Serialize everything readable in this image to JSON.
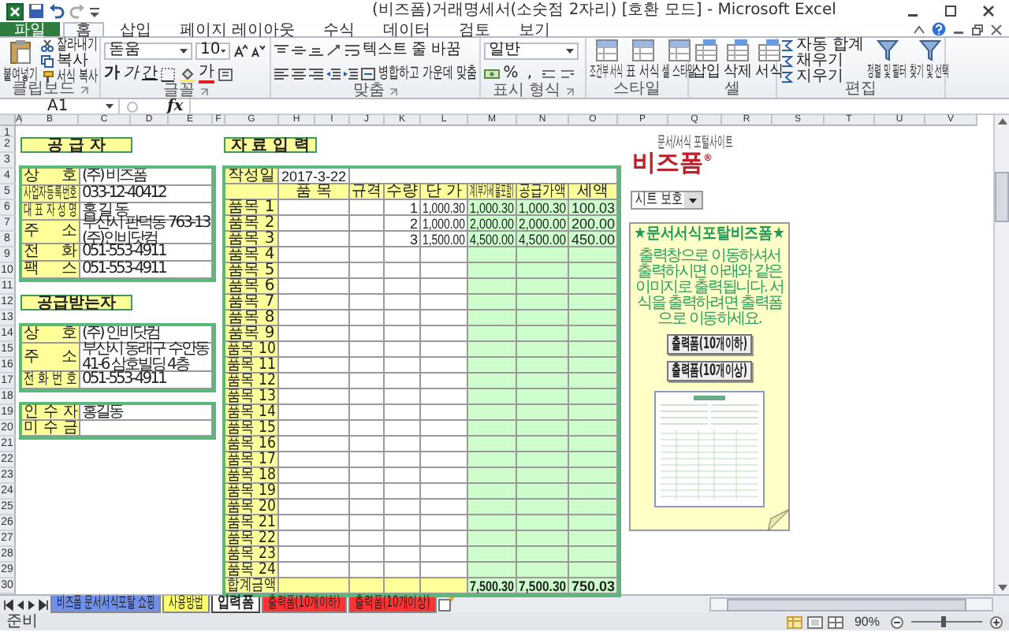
{
  "window": {
    "title": "(비즈폼)거래명세서(소숫점 2자리) [호환 모드] - Microsoft Excel"
  },
  "ribbon_tabs": [
    {
      "label": "파일",
      "kind": "file",
      "selected": false
    },
    {
      "label": "홈",
      "kind": "tab",
      "selected": true
    },
    {
      "label": "삽입",
      "kind": "tab",
      "selected": false
    },
    {
      "label": "페이지 레이아웃",
      "kind": "tab",
      "selected": false
    },
    {
      "label": "수식",
      "kind": "tab",
      "selected": false
    },
    {
      "label": "데이터",
      "kind": "tab",
      "selected": false
    },
    {
      "label": "검토",
      "kind": "tab",
      "selected": false
    },
    {
      "label": "보기",
      "kind": "tab",
      "selected": false
    }
  ],
  "ribbon_groups": [
    {
      "kind": "clipboard",
      "name": "클립보드",
      "paste": "붙여넣기",
      "cut": "잘라내기",
      "copy": "복사",
      "format_painter": "서식 복사"
    },
    {
      "kind": "font",
      "name": "글꼴",
      "font": "돋움",
      "size": "10",
      "bold": "가",
      "italic": "가",
      "underline": "간",
      "font_color": "가"
    },
    {
      "kind": "alignment",
      "name": "맞춤",
      "wrap": "텍스트 줄 바꿈",
      "merge": "병합하고 가운데 맞춤"
    },
    {
      "kind": "number",
      "name": "표시 형식",
      "format": "일반",
      "percent": "%",
      "comma": ","
    },
    {
      "kind": "styles",
      "name": "스타일",
      "buttons": [
        "조건부 서식",
        "표 서식",
        "셀 스타일"
      ]
    },
    {
      "kind": "cells",
      "name": "셀",
      "buttons": [
        "삽입",
        "삭제",
        "서식"
      ]
    },
    {
      "kind": "editing",
      "name": "편집",
      "small": [
        "자동 합계",
        "채우기",
        "지우기"
      ],
      "large": [
        "정렬 및 필터",
        "찾기 및 선택"
      ]
    }
  ],
  "formula_bar": {
    "cell": "A1",
    "function_label": "fx"
  },
  "column_headers": [
    "A",
    "B",
    "C",
    "D",
    "E",
    "F",
    "G",
    "H",
    "I",
    "J",
    "K",
    "L",
    "M",
    "N",
    "O",
    "P",
    "Q",
    "R",
    "S",
    "T",
    "U",
    "V"
  ],
  "row_headers": [
    "1",
    "2",
    "3",
    "4",
    "5",
    "6",
    "7",
    "8",
    "9",
    "10",
    "11",
    "12",
    "13",
    "14",
    "15",
    "16",
    "17",
    "18",
    "19",
    "20",
    "21",
    "22",
    "23",
    "24",
    "25",
    "26",
    "27",
    "28",
    "29",
    "30"
  ],
  "supplier": {
    "title": "공 급 자",
    "fields": [
      {
        "label": "상 호",
        "value": "(주) 비즈폼"
      },
      {
        "label": "사업자등록번호",
        "value": "033-12-40412"
      },
      {
        "label": "대 표 자 성 명",
        "value": "홍 길 동"
      },
      {
        "label": "주 소",
        "value": "부산시 판덕동 763-13 (주)인비닷컴"
      },
      {
        "label": "전 화",
        "value": "051-553-4911"
      },
      {
        "label": "팩 스",
        "value": "051-553-4911"
      }
    ]
  },
  "recipient": {
    "title": "공급받는자",
    "fields": [
      {
        "label": "상 호",
        "value": "(주) 인비닷컴"
      },
      {
        "label": "주 소",
        "value": "부산시 동래구 수안동 41-6 삼호빌딩 4층"
      },
      {
        "label": "전 화 번 호",
        "value": "051-553-4911"
      }
    ]
  },
  "receipt": {
    "fields": [
      {
        "label": "인 수 자",
        "value": "홍길동"
      },
      {
        "label": "미 수 금"
      }
    ]
  },
  "invoice": {
    "title": "자 료 입 력",
    "date_label": "작성일",
    "date": "2017-3-22",
    "columns": [
      "품 목",
      "규격",
      "수량",
      "단 가",
      "계(부가세율포함)",
      "공급가액",
      "세액"
    ],
    "items": [
      {
        "label": "품목 1",
        "qty": "1",
        "unit_price": "1,000.30",
        "total": "1,000.30",
        "supply": "1,000.30",
        "tax": "100.03"
      },
      {
        "label": "품목 2",
        "qty": "2",
        "unit_price": "1,000.00",
        "total": "2,000.00",
        "supply": "2,000.00",
        "tax": "200.00"
      },
      {
        "label": "품목 3",
        "qty": "3",
        "unit_price": "1,500.00",
        "total": "4,500.00",
        "supply": "4,500.00",
        "tax": "450.00"
      },
      {
        "label": "품목 4"
      },
      {
        "label": "품목 5"
      },
      {
        "label": "품목 6"
      },
      {
        "label": "품목 7"
      },
      {
        "label": "품목 8"
      },
      {
        "label": "품목 9"
      },
      {
        "label": "품목 10"
      },
      {
        "label": "품목 11"
      },
      {
        "label": "품목 12"
      },
      {
        "label": "품목 13"
      },
      {
        "label": "품목 14"
      },
      {
        "label": "품목 15"
      },
      {
        "label": "품목 16"
      },
      {
        "label": "품목 17"
      },
      {
        "label": "품목 18"
      },
      {
        "label": "품목 19"
      },
      {
        "label": "품목 20"
      },
      {
        "label": "품목 21"
      },
      {
        "label": "품목 22"
      },
      {
        "label": "품목 23"
      },
      {
        "label": "품목 24"
      }
    ],
    "totals": {
      "label": "합계금액",
      "total": "7,500.30",
      "supply": "7,500.30",
      "tax": "750.03"
    }
  },
  "logo": {
    "tagline": "문서/서식 포털사이트",
    "wordmark": "비즈폼$^{®}$"
  },
  "protect_dropdown": {
    "value": "시트 보호"
  },
  "note": {
    "title": "★문서서식포탈비즈폼★",
    "text": "출력창으로 이동하셔서 출력하시면 아래와 같은이미지로 출력됩니다. 서식을 출력하려면 출력폼으로 이동하세요.",
    "buttons": [
      "출력폼(10개이하)",
      "출력폼(10개이상)"
    ]
  },
  "sheet_tabs": [
    {
      "label": "비즈폼 문서서식포탈 쇼핑",
      "color": "#6f8fe8",
      "selected": false
    },
    {
      "label": "사용방법",
      "color": "#ffff66",
      "selected": false
    },
    {
      "label": "입력폼",
      "color": "#ffffff",
      "selected": true
    },
    {
      "label": "출력폼(10개이하)",
      "color": "#ff3333",
      "selected": false
    },
    {
      "label": "출력폼(10개이상)",
      "color": "#ff3333",
      "selected": false
    }
  ],
  "status_bar": {
    "status": "준비",
    "zoom": "90%",
    "zoom_slider": {
      "level": 0.45
    }
  }
}
